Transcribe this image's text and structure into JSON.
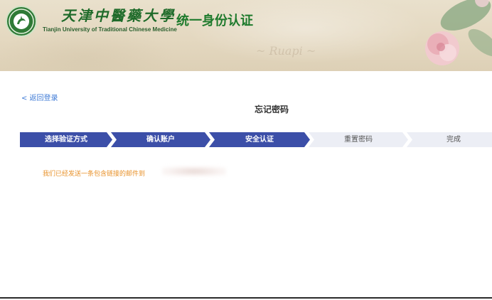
{
  "header": {
    "university_chinese": "天津中醫藥大學",
    "university_english": "Tianjin University of  Traditional Chinese Medicine",
    "system_title": "统一身份认证",
    "logo_icon": "university-seal-icon"
  },
  "nav": {
    "back_label": "< 返回登录"
  },
  "page": {
    "title": "忘记密码"
  },
  "steps": [
    {
      "label": "选择验证方式",
      "state": "done"
    },
    {
      "label": "确认账户",
      "state": "done"
    },
    {
      "label": "安全认证",
      "state": "current"
    },
    {
      "label": "重置密码",
      "state": "pending"
    },
    {
      "label": "完成",
      "state": "pending"
    }
  ],
  "message": {
    "text": "我们已经发送一条包含链接的邮件到"
  },
  "colors": {
    "step_active": "#3c4fa8",
    "step_inactive": "#eceef5",
    "link": "#3d7ad6",
    "message": "#e8922b",
    "brand_green": "#1e7a2c"
  }
}
